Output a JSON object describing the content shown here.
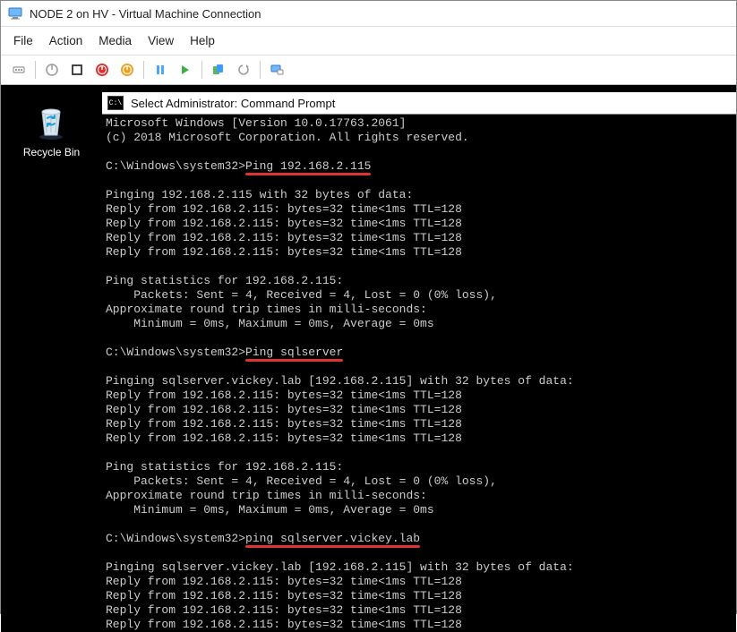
{
  "window": {
    "title": "NODE 2 on HV - Virtual Machine Connection"
  },
  "menu": {
    "file": "File",
    "action": "Action",
    "media": "Media",
    "view": "View",
    "help": "Help"
  },
  "desktop": {
    "recycle_bin": "Recycle Bin"
  },
  "cmd": {
    "title": "Select Administrator: Command Prompt",
    "header1": "Microsoft Windows [Version 10.0.17763.2061]",
    "header2": "(c) 2018 Microsoft Corporation. All rights reserved.",
    "prompt": "C:\\Windows\\system32>",
    "cmd1": "Ping 192.168.2.115",
    "cmd2": "Ping sqlserver",
    "cmd3": "ping sqlserver.vickey.lab",
    "ping_ip_header": "Pinging 192.168.2.115 with 32 bytes of data:",
    "ping_name_header": "Pinging sqlserver.vickey.lab [192.168.2.115] with 32 bytes of data:",
    "reply": "Reply from 192.168.2.115: bytes=32 time<1ms TTL=128",
    "stats_header": "Ping statistics for 192.168.2.115:",
    "stats_packets": "    Packets: Sent = 4, Received = 4, Lost = 0 (0% loss),",
    "rtt_header": "Approximate round trip times in milli-seconds:",
    "rtt_values": "    Minimum = 0ms, Maximum = 0ms, Average = 0ms"
  }
}
